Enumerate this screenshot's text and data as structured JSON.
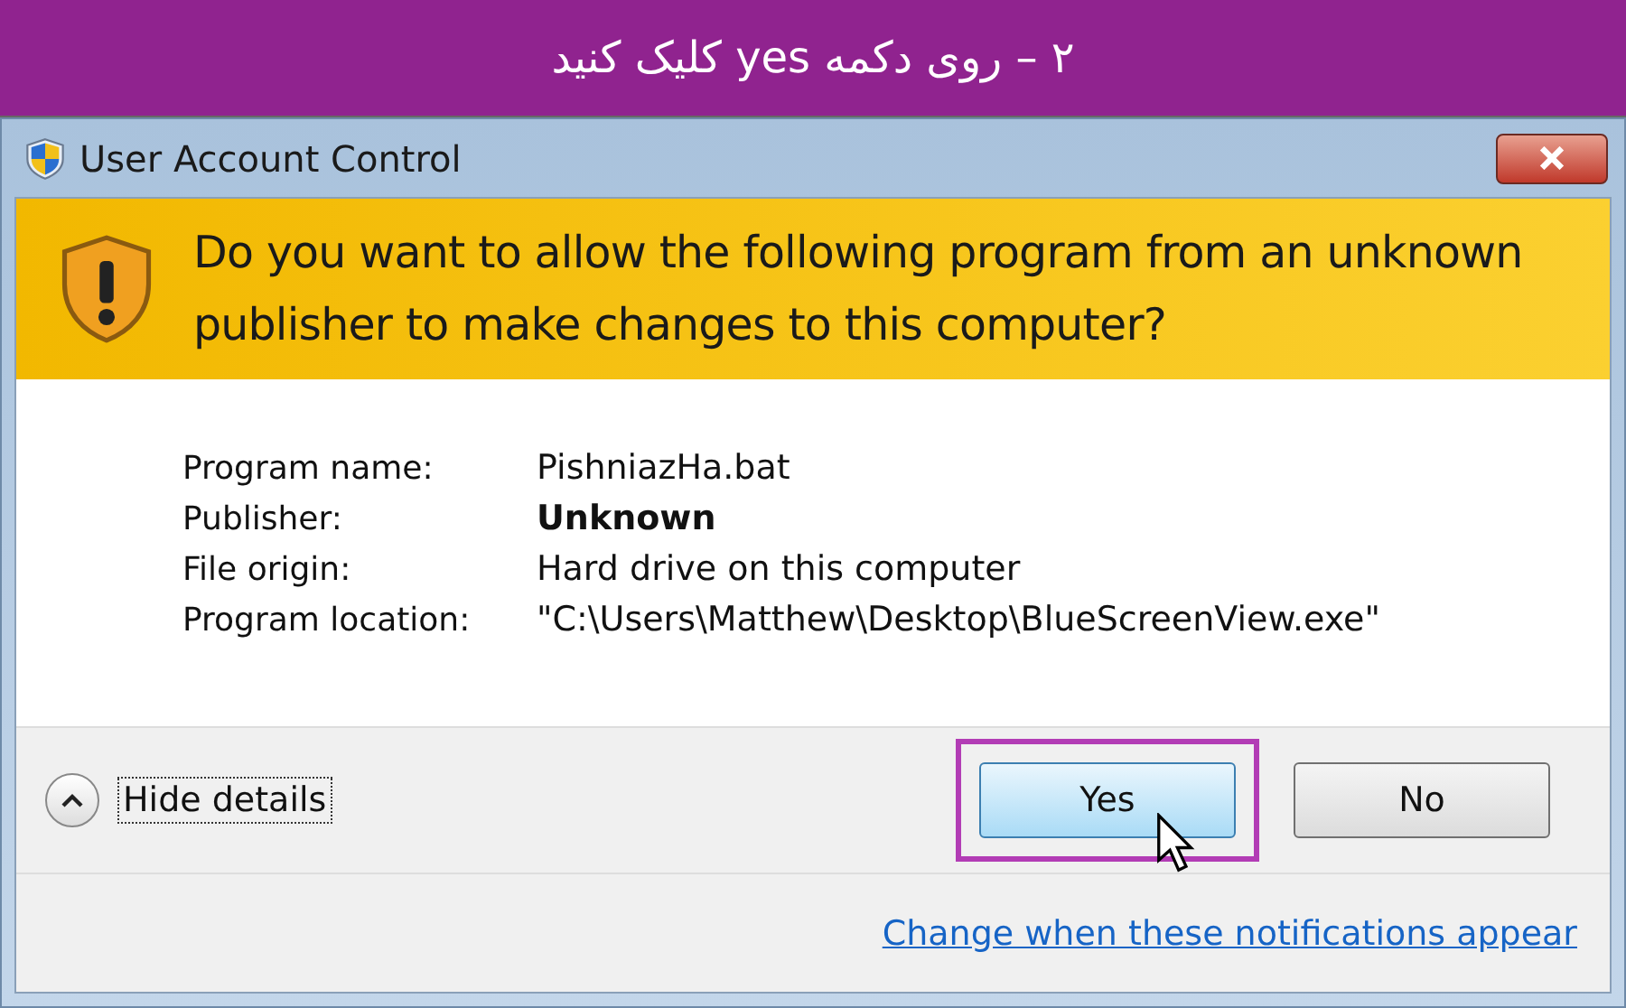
{
  "banner": {
    "text": "۲ – روی دکمه yes کلیک کنید"
  },
  "window": {
    "title": "User Account Control"
  },
  "question": "Do you want to allow the following program from an unknown publisher to make changes to this computer?",
  "details": [
    {
      "label": "Program name:",
      "value": "PishniazHa.bat",
      "bold": false
    },
    {
      "label": "Publisher:",
      "value": "Unknown",
      "bold": true
    },
    {
      "label": "File origin:",
      "value": "Hard drive on this computer",
      "bold": false
    },
    {
      "label": "Program location:",
      "value": "\"C:\\Users\\Matthew\\Desktop\\BlueScreenView.exe\"",
      "bold": false
    }
  ],
  "details_toggle": {
    "label": "Hide details",
    "expanded": true
  },
  "buttons": [
    {
      "label": "Yes",
      "highlighted": true
    },
    {
      "label": "No",
      "highlighted": false
    }
  ],
  "link": "Change when these notifications appear"
}
